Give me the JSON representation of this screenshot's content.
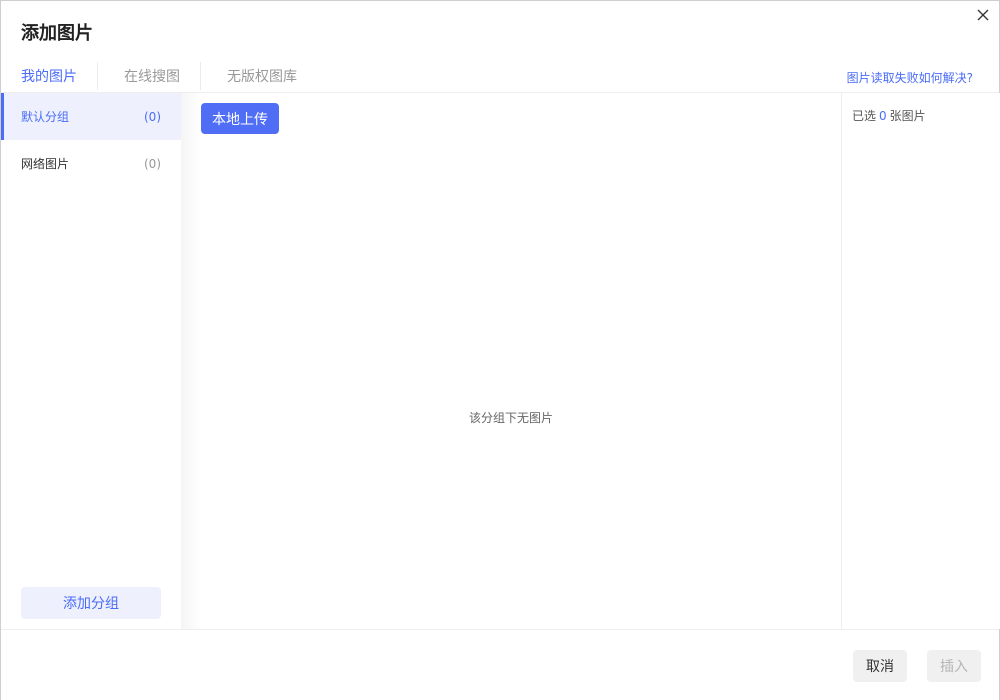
{
  "dialog": {
    "title": "添加图片"
  },
  "tabs": [
    {
      "label": "我的图片",
      "active": true
    },
    {
      "label": "在线搜图",
      "active": false
    },
    {
      "label": "无版权图库",
      "active": false
    }
  ],
  "help_link": "图片读取失败如何解决?",
  "groups": [
    {
      "label": "默认分组",
      "count": "(0)",
      "active": true
    },
    {
      "label": "网络图片",
      "count": "(0)",
      "active": false
    }
  ],
  "add_group_label": "添加分组",
  "upload_label": "本地上传",
  "empty_text": "该分组下无图片",
  "selected": {
    "prefix": "已选",
    "count": "0",
    "suffix": "张图片"
  },
  "footer": {
    "cancel_label": "取消",
    "insert_label": "插入"
  },
  "colors": {
    "accent": "#4a6cf7"
  }
}
